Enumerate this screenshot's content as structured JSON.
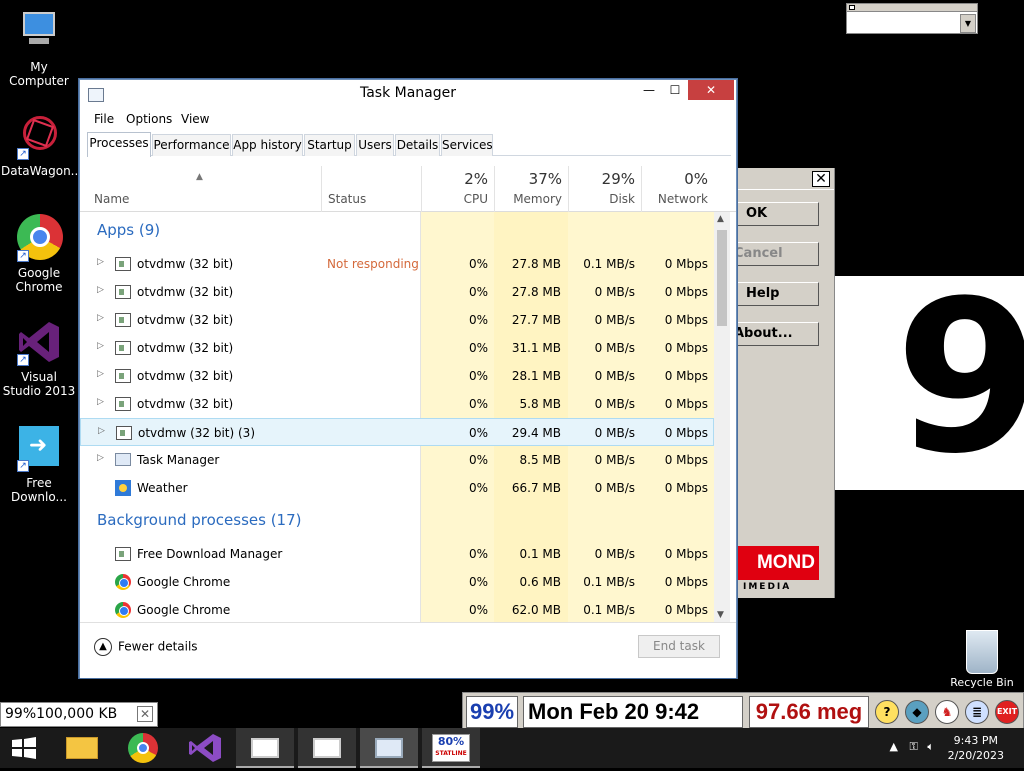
{
  "desktop": {
    "icons": [
      {
        "label": "My Computer",
        "icon": "computer-icon"
      },
      {
        "label": "DataWagon...",
        "icon": "datawagon-icon"
      },
      {
        "label": "Google Chrome",
        "icon": "chrome-icon"
      },
      {
        "label": "Visual Studio 2013",
        "icon": "visual-studio-icon"
      },
      {
        "label": "Free Downlo...",
        "icon": "free-download-manager-icon"
      }
    ],
    "recycle_bin": "Recycle Bin",
    "big_digit": "9"
  },
  "dialog": {
    "ok": "OK",
    "cancel": "Cancel",
    "help": "Help",
    "about": "About...",
    "logo": "MOND",
    "logo_sub": "IMEDIA"
  },
  "task_manager": {
    "title": "Task Manager",
    "menu": [
      "File",
      "Options",
      "View"
    ],
    "tabs": [
      "Processes",
      "Performance",
      "App history",
      "Startup",
      "Users",
      "Details",
      "Services"
    ],
    "active_tab": "Processes",
    "columns": {
      "name": "Name",
      "status": "Status",
      "cpu": {
        "pct": "2%",
        "label": "CPU"
      },
      "memory": {
        "pct": "37%",
        "label": "Memory"
      },
      "disk": {
        "pct": "29%",
        "label": "Disk"
      },
      "network": {
        "pct": "0%",
        "label": "Network"
      }
    },
    "groups": [
      {
        "label": "Apps (9)"
      },
      {
        "label": "Background processes (17)"
      }
    ],
    "apps": [
      {
        "name": "otvdmw (32 bit)",
        "status": "Not responding",
        "cpu": "0%",
        "memory": "27.8 MB",
        "disk": "0.1 MB/s",
        "network": "0 Mbps"
      },
      {
        "name": "otvdmw (32 bit)",
        "status": "",
        "cpu": "0%",
        "memory": "27.8 MB",
        "disk": "0 MB/s",
        "network": "0 Mbps"
      },
      {
        "name": "otvdmw (32 bit)",
        "status": "",
        "cpu": "0%",
        "memory": "27.7 MB",
        "disk": "0 MB/s",
        "network": "0 Mbps"
      },
      {
        "name": "otvdmw (32 bit)",
        "status": "",
        "cpu": "0%",
        "memory": "31.1 MB",
        "disk": "0 MB/s",
        "network": "0 Mbps"
      },
      {
        "name": "otvdmw (32 bit)",
        "status": "",
        "cpu": "0%",
        "memory": "28.1 MB",
        "disk": "0 MB/s",
        "network": "0 Mbps"
      },
      {
        "name": "otvdmw (32 bit)",
        "status": "",
        "cpu": "0%",
        "memory": "5.8 MB",
        "disk": "0 MB/s",
        "network": "0 Mbps"
      },
      {
        "name": "otvdmw (32 bit) (3)",
        "status": "",
        "cpu": "0%",
        "memory": "29.4 MB",
        "disk": "0 MB/s",
        "network": "0 Mbps"
      },
      {
        "name": "Task Manager",
        "status": "",
        "cpu": "0%",
        "memory": "8.5 MB",
        "disk": "0 MB/s",
        "network": "0 Mbps"
      },
      {
        "name": "Weather",
        "status": "",
        "cpu": "0%",
        "memory": "66.7 MB",
        "disk": "0 MB/s",
        "network": "0 Mbps"
      }
    ],
    "background": [
      {
        "name": "Free Download Manager",
        "cpu": "0%",
        "memory": "0.1 MB",
        "disk": "0 MB/s",
        "network": "0 Mbps"
      },
      {
        "name": "Google Chrome",
        "cpu": "0%",
        "memory": "0.6 MB",
        "disk": "0.1 MB/s",
        "network": "0 Mbps"
      },
      {
        "name": "Google Chrome",
        "cpu": "0%",
        "memory": "62.0 MB",
        "disk": "0.1 MB/s",
        "network": "0 Mbps"
      }
    ],
    "fewer_details": "Fewer details",
    "end_task": "End task"
  },
  "widgets": {
    "kb_readout": "99%100,000 KB",
    "cpu_pct": "99%",
    "date_text": "Mon Feb 20 9:42",
    "mem_text": "97.66 meg",
    "statline_pct": "80%",
    "statline_label": "STATLINE"
  },
  "taskbar": {
    "time": "9:43 PM",
    "date": "2/20/2023"
  }
}
